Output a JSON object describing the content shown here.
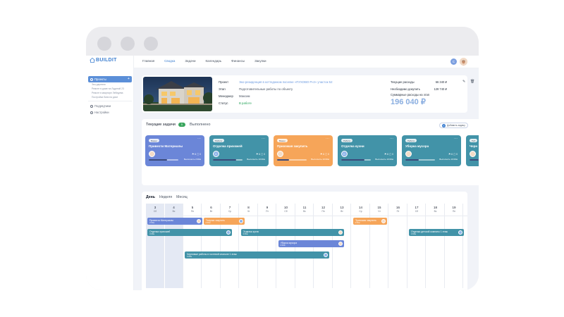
{
  "app": {
    "logo": "BUILDIT",
    "colors": {
      "accent": "#3f80d1",
      "blue": "#5b8fd8",
      "teal": "#4293a8",
      "orange": "#f6a559",
      "green": "#3aa55d",
      "periwinkle": "#6b86d8"
    }
  },
  "sidebar": {
    "projects": "Проекты",
    "sub_items": [
      "Эко-деревня",
      "Ремонт в доме на Лудиной 23",
      "Ремонт в квартире Лебедева",
      "Постройка бани на даче"
    ],
    "contractors": "Подрядчики",
    "settings": "Настройки"
  },
  "topbar": {
    "nav": [
      "Главная",
      "Сводка",
      "Задачи",
      "Календарь",
      "Финансы",
      "Закупки"
    ],
    "active": "Сводка",
    "avatar_letter": "С"
  },
  "project": {
    "labels": {
      "project": "Проект",
      "stage": "Этап",
      "manager": "Менеджер",
      "status": "Статус"
    },
    "project": "Эко-резиденция в коттеджном поселке «ПУХОВО Р»2» участок 52",
    "stage": "Подготовительные работы по объекту",
    "manager": "Максим",
    "status": "В работе",
    "costs": [
      {
        "label": "Текущие расходы",
        "value": "66 340 ₽"
      },
      {
        "label": "Необходимо докупить",
        "value": "129 740 ₽"
      }
    ],
    "total_label": "Суммарные расходы на этап",
    "total_value": "196 040 ₽"
  },
  "tasks": {
    "title": "Текущие задачи",
    "count": "5",
    "done_label": "Выполнено",
    "add_label": "Добавить задачу",
    "cards": [
      {
        "tag": "Важно",
        "title": "Привезти Материалы",
        "meta": "⚑ 6  ▢ 0",
        "due": "Выполнить 2:00м",
        "avatar": "",
        "progress": 0.62
      },
      {
        "tag": "Работа",
        "title": "Отделка прихожей",
        "meta": "⚑ 6  ▢ 0",
        "due": "Выполнить 10:00м",
        "avatar": "С",
        "progress": 0.78
      },
      {
        "tag": "Важно",
        "title": "Прихожая закупить",
        "meta": "⚑ 6  ▢ 0",
        "due": "Выполнить 10:00м",
        "avatar": "",
        "progress": 0.4
      },
      {
        "tag": "Работа",
        "title": "Отделка кухни",
        "meta": "⚑ 6  ▢ 0",
        "due": "Выполнить 10:00м",
        "avatar": "С",
        "progress": 0.78
      },
      {
        "tag": "Работа",
        "title": "Уборка мусора",
        "meta": "⚑ 6  ▢ 0",
        "due": "Выполнить 10:00м",
        "avatar": "",
        "progress": 0.45
      },
      {
        "tag": "Раб",
        "title": "Черн",
        "meta": "",
        "due": "",
        "avatar": "",
        "progress": 0.3
      }
    ]
  },
  "calendar": {
    "tabs": [
      "День",
      "Неделя",
      "Месяц"
    ],
    "days": [
      {
        "n": "3",
        "w": "Сб"
      },
      {
        "n": "4",
        "w": "Вс"
      },
      {
        "n": "5",
        "w": "Пн"
      },
      {
        "n": "6",
        "w": "Вт"
      },
      {
        "n": "7",
        "w": "Ср"
      },
      {
        "n": "8",
        "w": "Чт"
      },
      {
        "n": "9",
        "w": "Пт"
      },
      {
        "n": "10",
        "w": "Сб"
      },
      {
        "n": "11",
        "w": "Вс"
      },
      {
        "n": "12",
        "w": "Пн"
      },
      {
        "n": "13",
        "w": "Вт"
      },
      {
        "n": "14",
        "w": "Ср"
      },
      {
        "n": "15",
        "w": "Чт"
      },
      {
        "n": "16",
        "w": "Пт"
      },
      {
        "n": "17",
        "w": "Сб"
      },
      {
        "n": "18",
        "w": "Вс"
      },
      {
        "n": "19",
        "w": "Пн"
      }
    ],
    "events": [
      {
        "title": "Привезти Материалы",
        "sub": "2:00м",
        "color": "#6b86d8",
        "start": 0,
        "span": 3,
        "row": 0
      },
      {
        "title": "Покупка закупить",
        "sub": "2:00м",
        "color": "#f6a559",
        "start": 3,
        "span": 2.3,
        "row": 0
      },
      {
        "title": "Прихожая закупить",
        "sub": "2:00м",
        "color": "#f6a559",
        "start": 11,
        "span": 1.9,
        "row": 0
      },
      {
        "title": "Отделка прихожей",
        "sub": "3:00м",
        "color": "#4293a8",
        "start": 0,
        "span": 4.6,
        "row": 1
      },
      {
        "title": "Отделка кухни",
        "sub": "3:00м",
        "color": "#4293a8",
        "start": 5,
        "span": 5.6,
        "row": 1
      },
      {
        "title": "Отделка детской комнаты 1 этаж",
        "sub": "3:00м",
        "color": "#4293a8",
        "start": 14,
        "span": 3,
        "row": 1
      },
      {
        "title": "Уборка мусора",
        "sub": "2:00м",
        "color": "#6b86d8",
        "start": 7,
        "span": 3.6,
        "row": 2
      },
      {
        "title": "Черновые работы в гостевой спальне 1 этаж",
        "sub": "3:00м",
        "color": "#4293a8",
        "start": 2,
        "span": 7.8,
        "row": 3
      }
    ]
  }
}
